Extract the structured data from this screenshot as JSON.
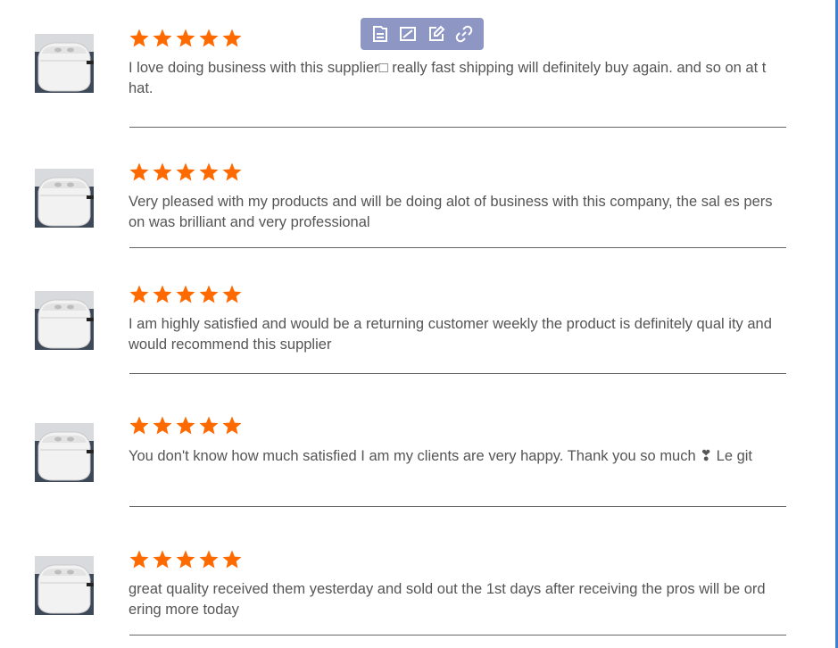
{
  "toolbar": {
    "buttons": [
      {
        "icon": "file-icon"
      },
      {
        "icon": "image-icon"
      },
      {
        "icon": "edit-icon"
      },
      {
        "icon": "link-icon"
      }
    ]
  },
  "reviews": [
    {
      "rating": 5,
      "text": "I love doing business with this supplier□ really fast shipping will definitely buy again. and so on at that."
    },
    {
      "rating": 5,
      "text": "Very pleased with my products and will be doing alot of business with this company, the sal es person was brilliant and very professional"
    },
    {
      "rating": 5,
      "text": "I am highly satisfied and would be a returning customer weekly the product is definitely qual ity and would recommend this supplier"
    },
    {
      "rating": 5,
      "text": "You don't know how much satisfied I am my clients are very happy. Thank you so much ❣ Le git"
    },
    {
      "rating": 5,
      "text": "great quality received them yesterday and sold out the 1st days after receiving the pros will be ordering more today"
    }
  ],
  "colors": {
    "star": "#ff6a00",
    "toolbar": "#8e96c4",
    "text": "#555555"
  }
}
